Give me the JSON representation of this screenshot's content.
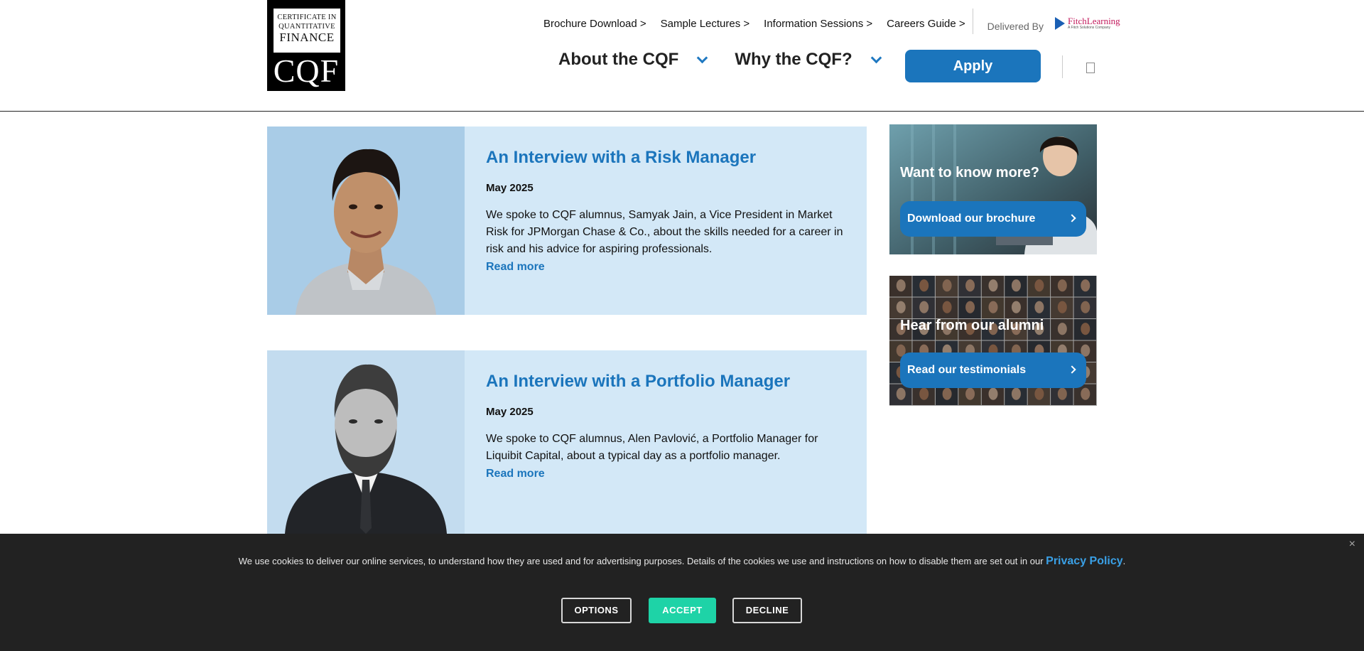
{
  "logo": {
    "line1": "CERTIFICATE IN",
    "line2": "QUANTITATIVE",
    "line3": "FINANCE",
    "acronym": "CQF"
  },
  "top_nav": [
    "Brochure Download >",
    "Sample Lectures >",
    "Information Sessions >",
    "Careers Guide >"
  ],
  "delivered_by": "Delivered By",
  "partner": {
    "name": "FitchLearning",
    "sub": "A Fitch Solutions Company"
  },
  "main_nav": [
    "About the CQF",
    "Why the CQF?"
  ],
  "apply_label": "Apply",
  "articles": [
    {
      "title": "An Interview with a Risk Manager",
      "date": "May 2025",
      "text": "We spoke to CQF alumnus, Samyak Jain, a Vice President in Market Risk for JPMorgan Chase & Co., about the skills needed for a career in risk and his advice for aspiring professionals.",
      "link": "Read more"
    },
    {
      "title": "An Interview with a Portfolio Manager",
      "date": "May 2025",
      "text": "We spoke to CQF alumnus, Alen Pavlović, a Portfolio Manager for Liquibit Capital, about a typical day as a portfolio manager.",
      "link": "Read more"
    }
  ],
  "promos": [
    {
      "heading": "Want to know more?",
      "button": "Download our brochure"
    },
    {
      "heading": "Hear from our alumni",
      "button": "Read our testimonials"
    }
  ],
  "cookie": {
    "text": "We use cookies to deliver our online services, to understand how they are used and for advertising purposes. Details of the cookies we use and instructions on how to disable them are set out in our",
    "link": "Privacy Policy",
    "period": ".",
    "close": "×",
    "options": "OPTIONS",
    "accept": "ACCEPT",
    "decline": "DECLINE"
  },
  "colors": {
    "brand_blue": "#1b75bc",
    "card_bg": "#d3e8f7",
    "accept_green": "#1ed3a7",
    "cookie_bg": "#222222"
  }
}
